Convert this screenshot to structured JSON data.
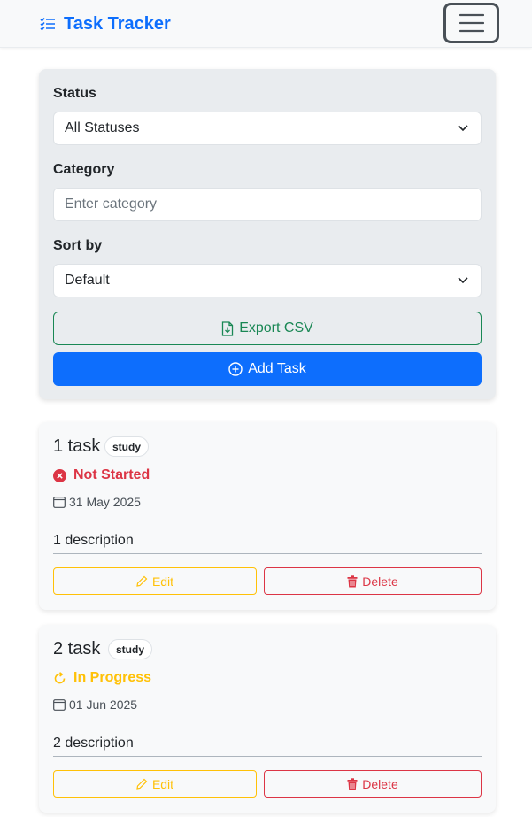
{
  "navbar": {
    "brand_icon": "list-check-icon",
    "brand_text": "Task Tracker",
    "menu_icon": "hamburger-icon",
    "brand_color": "#0d6efd"
  },
  "filters": {
    "status_label": "Status",
    "status_value": "All Statuses",
    "category_label": "Category",
    "category_placeholder": "Enter category",
    "sort_label": "Sort by",
    "sort_value": "Default",
    "export_label": "Export CSV",
    "export_icon": "file-download-icon",
    "add_label": "Add Task",
    "add_icon": "plus-circle-icon"
  },
  "tasks": [
    {
      "title": "1 task",
      "category": "study",
      "status": "Not Started",
      "status_icon": "x-circle-icon",
      "status_color": "#dc3545",
      "date": "31 May 2025",
      "description": "1 description",
      "edit_label": "Edit",
      "delete_label": "Delete"
    },
    {
      "title": "2 task",
      "category": "study",
      "status": "In Progress",
      "status_icon": "refresh-icon",
      "status_color": "#ffc107",
      "date": "01 Jun 2025",
      "description": "2 description",
      "edit_label": "Edit",
      "delete_label": "Delete"
    }
  ]
}
